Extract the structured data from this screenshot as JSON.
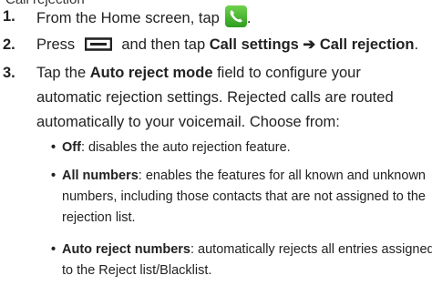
{
  "cut_line": {
    "label": "Call rejection"
  },
  "steps": [
    {
      "num": "1.",
      "text": "From the Home screen, tap"
    },
    {
      "num": "2.",
      "pre": "Press",
      "mid": "and then tap",
      "link1": "Call settings",
      "arrow": "➔",
      "link2": "Call rejection",
      "end": "."
    },
    {
      "num": "3.",
      "pre": "Tap the",
      "bold": "Auto reject mode",
      "lines": [
        "field to configure your",
        "automatic rejection settings. Rejected calls are routed",
        "automatically to your voicemail. Choose from:"
      ]
    }
  ],
  "bullets": [
    {
      "term": "Off",
      "lines": [
        ": disables the auto rejection feature."
      ]
    },
    {
      "term": "All numbers",
      "lines": [
        ": enables the features for all known and unknown",
        "numbers, including those contacts that are not assigned to the",
        "rejection list."
      ]
    },
    {
      "term": "Auto reject numbers",
      "lines": [
        ": automatically rejects all entries assigned",
        "to the Reject list/Blacklist."
      ]
    }
  ],
  "icons": {
    "phone": "phone-app-icon",
    "menu": "menu-key-icon",
    "phone_color": "#3aa82a"
  }
}
